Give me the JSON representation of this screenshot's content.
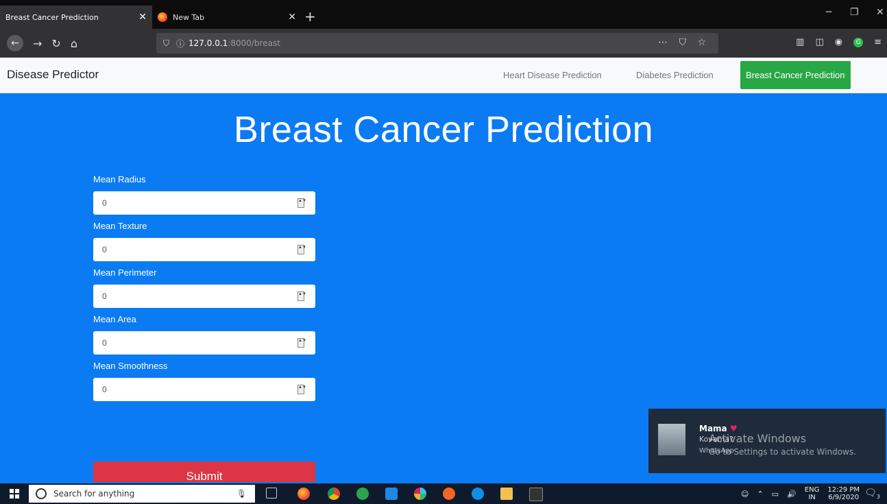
{
  "browser": {
    "tabs": [
      {
        "title": "Breast Cancer Prediction",
        "active": true
      },
      {
        "title": "New Tab",
        "active": false
      }
    ],
    "url_host": "127.0.0.1",
    "url_path": ":8000/breast"
  },
  "site": {
    "brand": "Disease Predictor",
    "nav": [
      {
        "label": "Heart Disease Prediction"
      },
      {
        "label": "Diabetes Prediction"
      },
      {
        "label": "Breast Cancer Prediction",
        "active": true
      }
    ]
  },
  "main": {
    "title": "Breast Cancer Prediction",
    "fields": [
      {
        "label": "Mean Radius",
        "value": "0"
      },
      {
        "label": "Mean Texture",
        "value": "0"
      },
      {
        "label": "Mean Perimeter",
        "value": "0"
      },
      {
        "label": "Mean Area",
        "value": "0"
      },
      {
        "label": "Mean Smoothness",
        "value": "0"
      }
    ],
    "submit_label": "Submit"
  },
  "notification": {
    "sender": "Mama",
    "message": "Kovama?",
    "app": "WhatsApp"
  },
  "watermark": {
    "line1": "Activate Windows",
    "line2": "Go to Settings to activate Windows."
  },
  "taskbar": {
    "search_placeholder": "Search for anything",
    "lang": "ENG",
    "region": "IN",
    "time": "12:29 PM",
    "date": "6/9/2020",
    "notif_count": "3"
  },
  "colors": {
    "page_bg": "#0b7bf3",
    "active_nav": "#28a745",
    "submit": "#dc3545"
  }
}
